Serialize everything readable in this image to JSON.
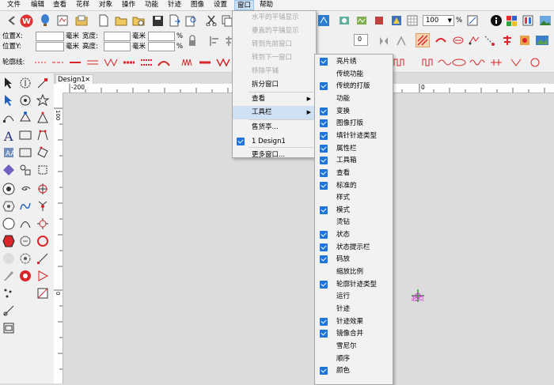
{
  "menubar": [
    "文件",
    "编辑",
    "查看",
    "花样",
    "对象",
    "操作",
    "功能",
    "针迹",
    "图像",
    "设置",
    "窗口",
    "帮助"
  ],
  "zoom": {
    "value": "100",
    "unit": "%"
  },
  "position_bar": {
    "x_label": "位置X:",
    "y_label": "位置Y:",
    "unit1": "毫米",
    "width_label": "宽度:",
    "unit2": "毫米",
    "pct1": "%",
    "unit3": "毫米",
    "height_label": "高度:",
    "unit4": "毫米",
    "pct2": "%",
    "num1": "0"
  },
  "outline_label": "轮廓线:",
  "doc_tab": {
    "title": "Design1",
    "close": "✕"
  },
  "ruler": {
    "h_ticks": [
      "-200",
      "0"
    ],
    "v_ticks": [
      "100",
      "0"
    ]
  },
  "canvas": {
    "marker_label": "起点"
  },
  "window_menu": {
    "items": [
      {
        "label": "水平的平铺显示",
        "disabled": true
      },
      {
        "label": "垂直的平铺显示",
        "disabled": true
      },
      {
        "label": "转到先前窗口",
        "disabled": true
      },
      {
        "label": "转到下一窗口",
        "disabled": true
      },
      {
        "label": "移除平铺",
        "disabled": true
      },
      {
        "label": "拆分窗口",
        "disabled": false
      },
      {
        "label": "查看",
        "disabled": false,
        "submenu": true
      },
      {
        "label": "工具栏",
        "disabled": false,
        "submenu": true,
        "highlighted": true
      },
      {
        "label": "售货亭...",
        "disabled": false
      },
      {
        "label": "1 Design1",
        "disabled": false,
        "checked": true
      },
      {
        "label": "更多窗口...",
        "disabled": false
      }
    ]
  },
  "toolbar_submenu": {
    "items": [
      {
        "label": "亮片绣",
        "checked": true
      },
      {
        "label": "传统功能",
        "checked": false
      },
      {
        "label": "传统的打版",
        "checked": true
      },
      {
        "label": "功能",
        "checked": false
      },
      {
        "label": "变换",
        "checked": true
      },
      {
        "label": "图像打版",
        "checked": true
      },
      {
        "label": "填针针迹类型",
        "checked": true
      },
      {
        "label": "属性栏",
        "checked": true
      },
      {
        "label": "工具箱",
        "checked": true
      },
      {
        "label": "查看",
        "checked": true
      },
      {
        "label": "标准的",
        "checked": true
      },
      {
        "label": "样式",
        "checked": false
      },
      {
        "label": "模式",
        "checked": true
      },
      {
        "label": "烫钻",
        "checked": false
      },
      {
        "label": "状态",
        "checked": true
      },
      {
        "label": "状态提示栏",
        "checked": true
      },
      {
        "label": "码放",
        "checked": true
      },
      {
        "label": "缩放比例",
        "checked": false
      },
      {
        "label": "轮廓针迹类型",
        "checked": true
      },
      {
        "label": "运行",
        "checked": false
      },
      {
        "label": "针迹",
        "checked": false
      },
      {
        "label": "针迹效果",
        "checked": true
      },
      {
        "label": "镜像合并",
        "checked": true
      },
      {
        "label": "雪尼尔",
        "checked": false
      },
      {
        "label": "顺序",
        "checked": false
      },
      {
        "label": "颜色",
        "checked": true
      }
    ]
  },
  "colors": {
    "accent": "#1e74d8",
    "stitch_red": "#d8262a",
    "menu_highlight": "#cfe0f3"
  }
}
